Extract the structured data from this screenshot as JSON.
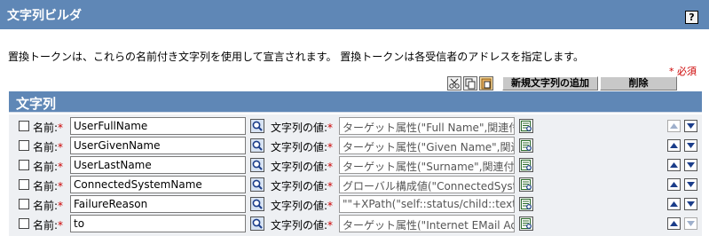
{
  "header": {
    "title": "文字列ビルダ",
    "help_label": "?"
  },
  "description": "置換トークンは、これらの名前付き文字列を使用して宣言されます。 置換トークンは各受信者のアドレスを指定します。",
  "required_note": "* 必須",
  "toolbar": {
    "add_label": "新規文字列の追加",
    "delete_label": "削除",
    "icons": [
      "cut-icon",
      "copy-icon",
      "paste-icon"
    ]
  },
  "section": {
    "title": "文字列"
  },
  "labels": {
    "name": "名前:",
    "value": "文字列の値:",
    "required_mark": "*"
  },
  "rows": [
    {
      "name": "UserFullName",
      "value": "ターゲット属性(\"Full Name\",関連付け"
    },
    {
      "name": "UserGivenName",
      "value": "ターゲット属性(\"Given Name\",関連付"
    },
    {
      "name": "UserLastName",
      "value": "ターゲット属性(\"Surname\",関連付けさ"
    },
    {
      "name": "ConnectedSystemName",
      "value": "グローバル構成値(\"ConnectedSystemN"
    },
    {
      "name": "FailureReason",
      "value": "\"\"+XPath(\"self::status/child::text("
    },
    {
      "name": "to",
      "value": "ターゲット属性(\"Internet EMail Addres"
    }
  ],
  "colors": {
    "header_bg": "#5f87b6",
    "rows_bg": "#eef0f3",
    "required": "#cc0000"
  }
}
